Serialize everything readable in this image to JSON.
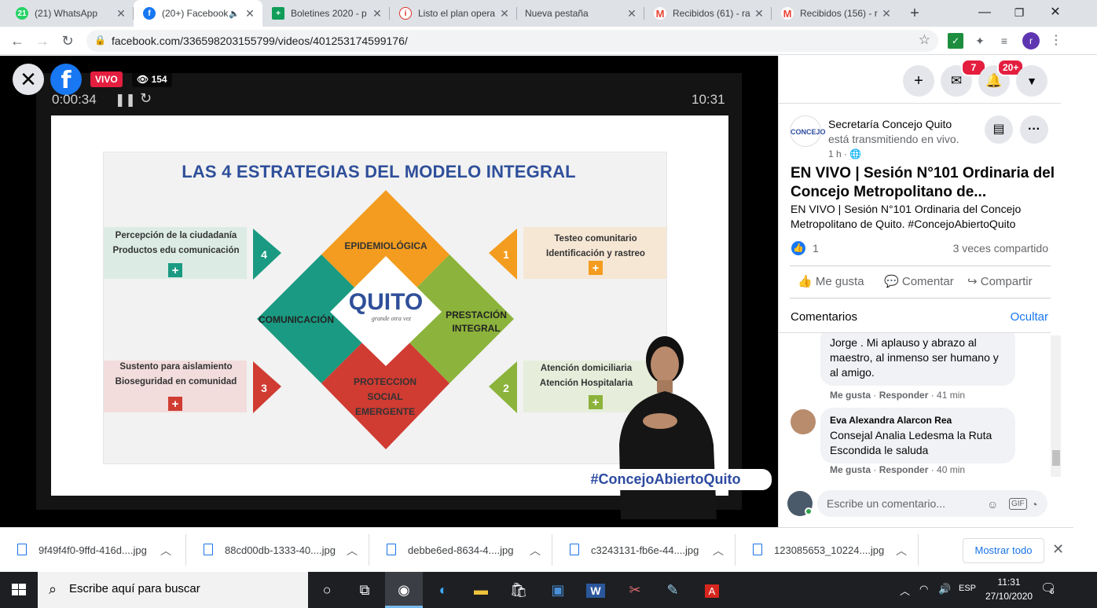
{
  "browser": {
    "tabs": [
      {
        "label": "(21) WhatsApp",
        "color": "#25d366",
        "glyph": "21"
      },
      {
        "label": "(20+) Facebook",
        "color": "#1877f2",
        "glyph": "f"
      },
      {
        "label": "Boletines 2020 - p",
        "color": "#0f9d58",
        "glyph": "+"
      },
      {
        "label": "Listo el plan opera",
        "color": "#d93025",
        "glyph": "i"
      },
      {
        "label": "Nueva pestaña",
        "color": "",
        "glyph": ""
      },
      {
        "label": "Recibidos (61) - ra",
        "color": "#ea4335",
        "glyph": "M"
      },
      {
        "label": "Recibidos (156) - r",
        "color": "#ea4335",
        "glyph": "M"
      }
    ],
    "url": "facebook.com/336598203155799/videos/401253174599176/",
    "profile_initial": "r"
  },
  "video": {
    "live_label": "VIVO",
    "viewers": "154",
    "elapsed": "0:00:34",
    "clock": "10:31",
    "hashtag": "#ConcejoAbiertoQuito",
    "slide": {
      "title": "LAS 4 ESTRATEGIAS DEL MODELO INTEGRAL",
      "center_logo": "QUITO",
      "center_tagline": "grande otra vez",
      "diamonds": {
        "top": "EPIDEMIOLÓGICA",
        "left": "COMUNICACIÓN",
        "right_line1": "PRESTACIÓN",
        "right_line2": "INTEGRAL",
        "bottom_line1": "PROTECCION",
        "bottom_line2": "SOCIAL",
        "bottom_line3": "EMERGENTE"
      },
      "boxes": {
        "top_left_line1": "Percepción de la ciudadanía",
        "top_left_line2": "Productos edu comunicación",
        "top_left_num": "4",
        "top_right_line1": "Testeo comunitario",
        "top_right_line2": "Identificación y rastreo",
        "top_right_num": "1",
        "bottom_left_line1": "Sustento para aislamiento",
        "bottom_left_line2": "Bioseguridad en comunidad",
        "bottom_left_num": "3",
        "bottom_right_line1": "Atención domiciliaria",
        "bottom_right_line2": "Atención Hospitalaria",
        "bottom_right_num": "2",
        "plus": "+"
      },
      "colors": {
        "orange": "#f39c1f",
        "green": "#8cb33b",
        "red": "#d03b32",
        "teal": "#1a9a82",
        "title": "#2f4f9a"
      }
    }
  },
  "panel": {
    "messenger_badge": "7",
    "notifications_badge": "20+",
    "page_logo_text": "CONCEJO",
    "page_name": "Secretaría Concejo Quito",
    "page_status": "está transmitiendo en vivo.",
    "post_time": "1 h ·",
    "post_title": "EN VIVO | Sesión N°101 Ordinaria del Concejo Metropolitano de...",
    "post_desc": "EN VIVO | Sesión N°101 Ordinaria del Concejo Metropolitano de Quito. #ConcejoAbiertoQuito",
    "like_count": "1",
    "shares": "3 veces compartido",
    "actions": {
      "like": "Me gusta",
      "comment": "Comentar",
      "share": "Compartir"
    },
    "comments_label": "Comentarios",
    "hide_label": "Ocultar",
    "comments": [
      {
        "author": "",
        "text": "Jorge . Mi aplauso y abrazo al maestro, al inmenso ser humano y al amigo.",
        "like": "Me gusta",
        "reply": "Responder",
        "time": "41 min"
      },
      {
        "author": "Eva Alexandra Alarcon Rea",
        "text": "Consejal Analia Ledesma la Ruta Escondida le saluda",
        "like": "Me gusta",
        "reply": "Responder",
        "time": "40 min"
      }
    ],
    "comment_placeholder": "Escribe un comentario..."
  },
  "downloads": {
    "items": [
      "9f49f4f0-9ffd-416d....jpg",
      "88cd00db-1333-40....jpg",
      "debbe6ed-8634-4....jpg",
      "c3243131-fb6e-44....jpg",
      "123085653_10224....jpg"
    ],
    "show_all": "Mostrar todo"
  },
  "taskbar": {
    "search_placeholder": "Escribe aquí para buscar",
    "lang": "ESP",
    "time": "11:31",
    "date": "27/10/2020",
    "notif_count": "6"
  }
}
